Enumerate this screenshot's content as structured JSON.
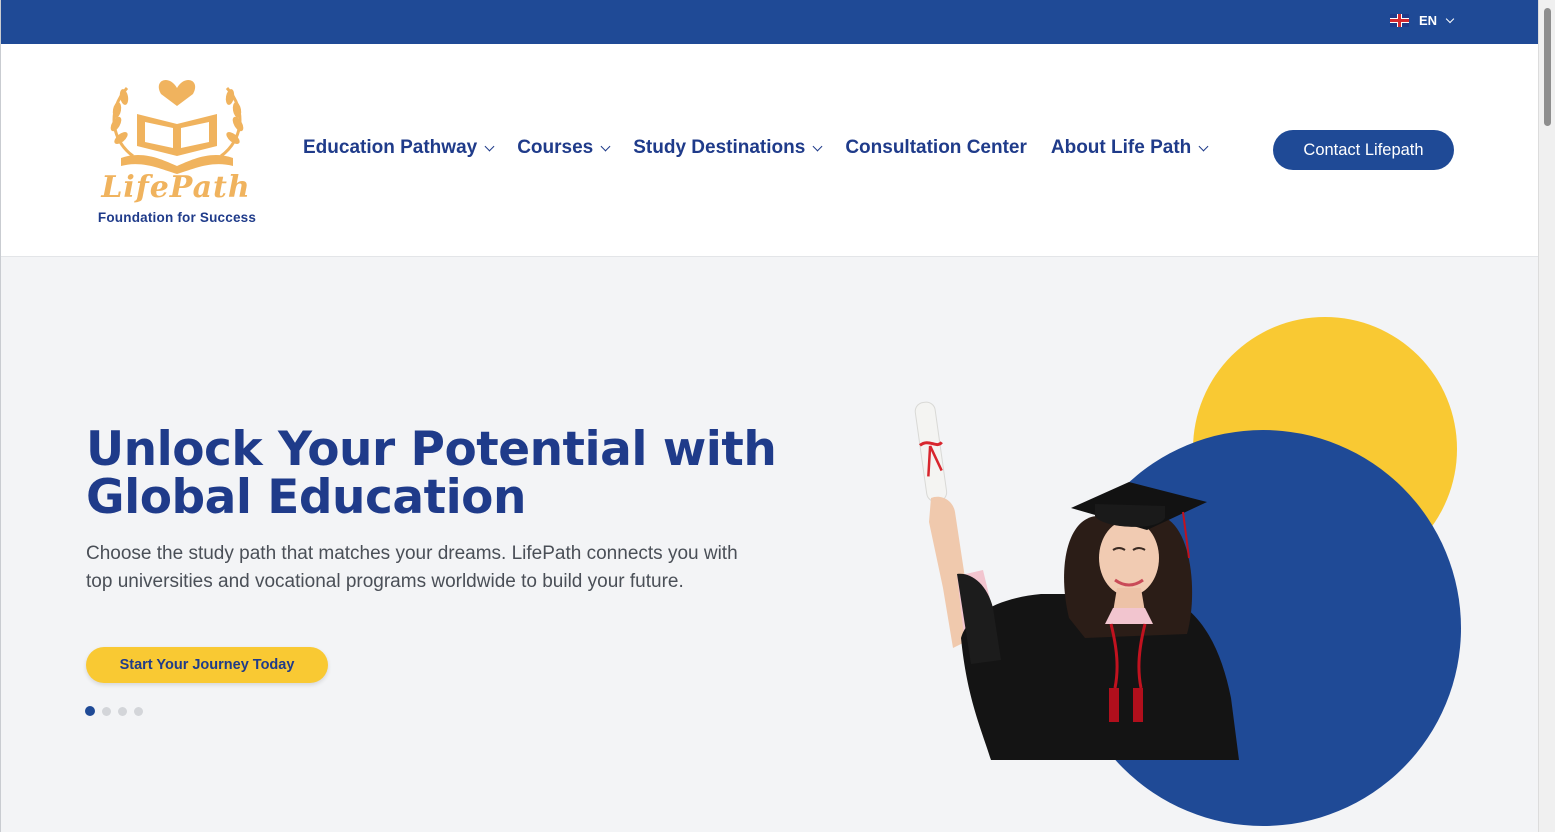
{
  "topbar": {
    "language": "EN",
    "flag_icon": "uk-flag-icon"
  },
  "logo": {
    "wordmark": "LifePath",
    "tagline": "Foundation for Success"
  },
  "nav": {
    "items": [
      {
        "label": "Education Pathway",
        "has_dropdown": true
      },
      {
        "label": "Courses",
        "has_dropdown": true
      },
      {
        "label": "Study Destinations",
        "has_dropdown": true
      },
      {
        "label": "Consultation Center",
        "has_dropdown": false
      },
      {
        "label": "About Life Path",
        "has_dropdown": true
      }
    ],
    "contact_label": "Contact Lifepath"
  },
  "hero": {
    "title": "Unlock Your Potential with Global Education",
    "text": "Choose the study path that matches your dreams. LifePath connects you with top universities and vocational programs worldwide to build your future.",
    "cta_label": "Start Your Journey Today",
    "slides": {
      "count": 4,
      "active": 1
    }
  },
  "colors": {
    "brand_blue": "#1f4a96",
    "accent_yellow": "#f9c933",
    "logo_gold": "#f0b35e"
  }
}
